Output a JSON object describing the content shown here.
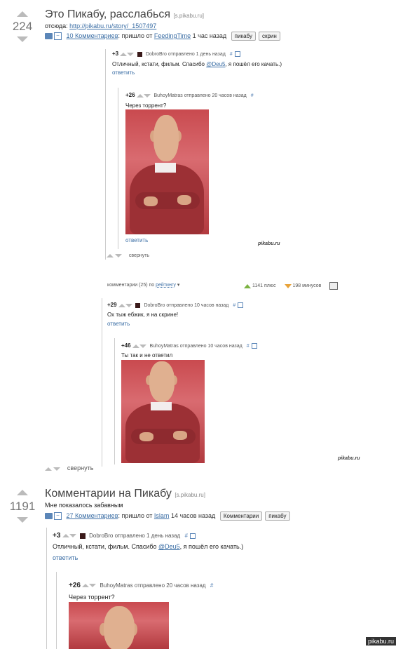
{
  "post1": {
    "score": "224",
    "title": "Это Пикабу, расслабься",
    "domain": "[s.pikabu.ru]",
    "source_label": "отсюда:",
    "source_url": "http://pikabu.ru/story/_1507497",
    "comments_link": "10 Комментариев",
    "posted_from": ": пришло от",
    "author": "FeedingTime",
    "time": "1 час назад",
    "tags": [
      "пикабу",
      "скрин"
    ]
  },
  "c1": {
    "score": "+3",
    "user": "DobroBro",
    "sent": "отправлено 1 день назад",
    "text": "Отличный, кстати, фильм. Спасибо ",
    "mention": "@Deu5",
    "text_end": ", я пошёл его качать.)",
    "reply": "ответить"
  },
  "c2": {
    "score": "+26",
    "user": "BuhoyMatras",
    "sent": "отправлено 20 часов назад",
    "text": "Через торрент?",
    "reply": "ответить",
    "watermark": "pikabu.ru"
  },
  "collapse1": "свернуть",
  "toolbar": {
    "comments": "комментарии (25) по",
    "sort": "рейтингу",
    "plus": "1141 плюс",
    "minus": "198 минусов"
  },
  "c3": {
    "score": "+29",
    "user": "DobroBro",
    "sent": "отправлено 10 часов назад",
    "text": "Ох тыж ебжик, я на скрине!",
    "reply": "ответить"
  },
  "c4": {
    "score": "+46",
    "user": "BuhoyMatras",
    "sent": "отправлено 10 часов назад",
    "text": "Ты так и не ответил",
    "watermark": "pikabu.ru"
  },
  "collapse2": "свернуть",
  "post2": {
    "score": "1191",
    "title": "Комментарии на Пикабу",
    "domain": "[s.pikabu.ru]",
    "subtitle": "Мне показалось забавным",
    "comments_link": "27 Комментариев",
    "posted_from": ": пришло от",
    "author": "Islam",
    "time": "14 часов назад",
    "tags": [
      "Комментарии",
      "пикабу"
    ]
  },
  "c5": {
    "score": "+3",
    "user": "DobroBro",
    "sent": "отправлено 1 день назад",
    "text": "Отличный, кстати, фильм. Спасибо ",
    "mention": "@Deu5",
    "text_end": ", я пошёл его качать.)",
    "reply": "ответить"
  },
  "c6": {
    "score": "+26",
    "user": "BuhoyMatras",
    "sent": "отправлено 20 часов назад",
    "text": "Через торрент?"
  },
  "footer_watermark": "pikabu.ru"
}
